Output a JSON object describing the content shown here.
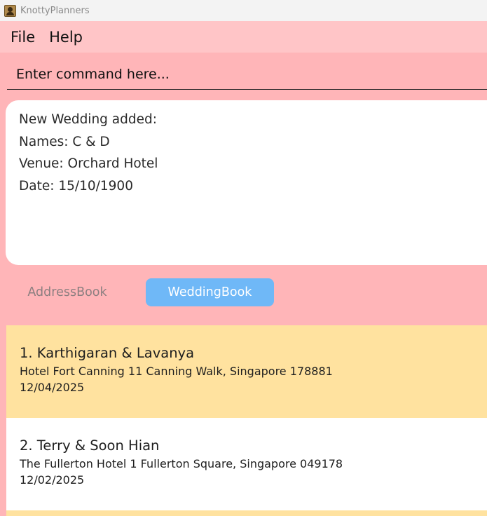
{
  "window": {
    "title": "KnottyPlanners"
  },
  "menu": {
    "file": "File",
    "help": "Help"
  },
  "command": {
    "placeholder": "Enter command here..."
  },
  "result": {
    "lines": [
      "New Wedding added:",
      "Names: C & D",
      "Venue: Orchard Hotel",
      "Date: 15/10/1900"
    ]
  },
  "tabs": {
    "address_book": "AddressBook",
    "wedding_book": "WeddingBook",
    "active": "WeddingBook"
  },
  "weddings": [
    {
      "title": "1. Karthigaran & Lavanya",
      "venue": "Hotel Fort Canning 11 Canning Walk, Singapore 178881",
      "date": "12/04/2025"
    },
    {
      "title": "2. Terry & Soon Hian",
      "venue": "The Fullerton Hotel 1 Fullerton Square, Singapore 049178",
      "date": "12/02/2025"
    }
  ],
  "colors": {
    "background": "#ffb5b8",
    "menubar": "#ffc5c7",
    "active_tab": "#6fb8f7",
    "card_odd": "#ffe29f",
    "card_even": "#ffffff"
  }
}
